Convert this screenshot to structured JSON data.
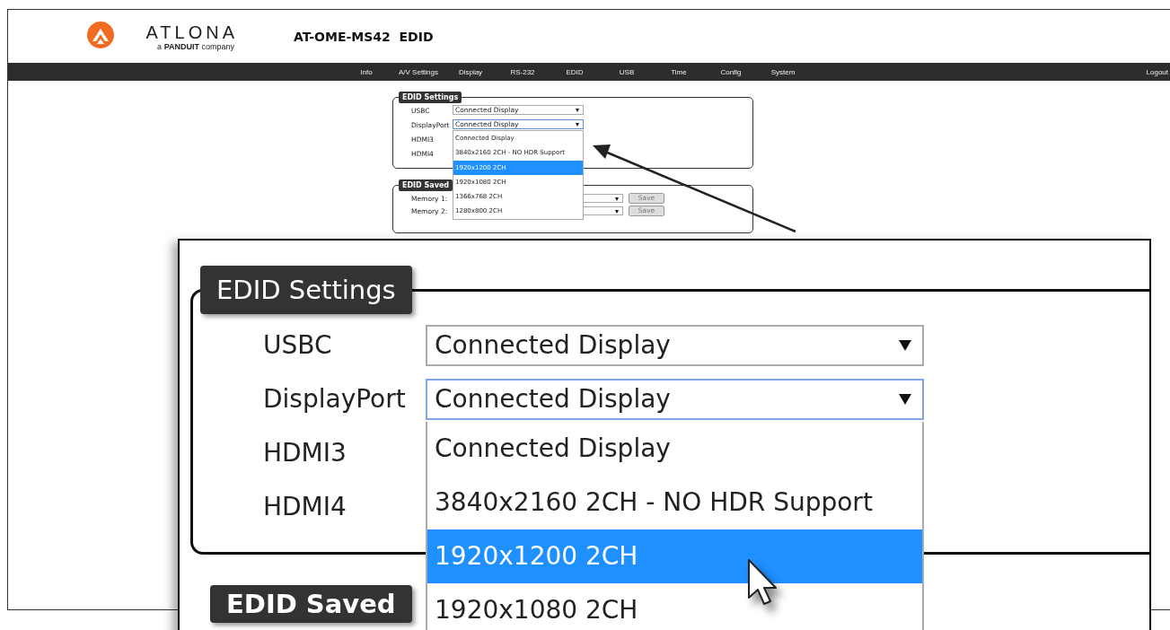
{
  "header": {
    "logo": {
      "wordmark": "ATLONA",
      "tagline": "a **PANDUIT** company"
    },
    "title": "AT-OME-MS42  EDID"
  },
  "nav": {
    "items": [
      "Info",
      "A/V Settings",
      "Display",
      "RS-232",
      "EDID",
      "USB",
      "Time",
      "Config",
      "System"
    ],
    "logout": "Logout"
  },
  "edid_settings": {
    "title": "EDID Settings",
    "inputs": [
      {
        "label": "USBC",
        "value": "Connected Display",
        "open": false
      },
      {
        "label": "DisplayPort",
        "value": "Connected Display",
        "open": true
      },
      {
        "label": "HDMI3"
      },
      {
        "label": "HDMI4"
      }
    ],
    "dropdown_options": [
      {
        "label": "Connected Display",
        "selected": false
      },
      {
        "label": "3840x2160 2CH - NO HDR Support",
        "selected": false
      },
      {
        "label": "1920x1200 2CH",
        "selected": true
      },
      {
        "label": "1920x1080 2CH",
        "selected": false
      },
      {
        "label": "1366x768 2CH",
        "selected": false
      },
      {
        "label": "1280x800 2CH",
        "selected": false
      }
    ]
  },
  "edid_saved": {
    "title": "EDID Saved",
    "rows": [
      {
        "label": "Memory 1:",
        "button": "Save"
      },
      {
        "label": "Memory 2:",
        "button": "Save"
      }
    ]
  },
  "zoom_inset": {
    "edid_settings": {
      "title": "EDID Settings",
      "inputs": [
        {
          "label": "USBC",
          "value": "Connected Display",
          "open": false
        },
        {
          "label": "DisplayPort",
          "value": "Connected Display",
          "open": true
        },
        {
          "label": "HDMI3"
        },
        {
          "label": "HDMI4"
        }
      ],
      "dropdown_options": [
        {
          "label": "Connected Display",
          "selected": false
        },
        {
          "label": "3840x2160 2CH - NO HDR Support",
          "selected": false
        },
        {
          "label": "1920x1200 2CH",
          "selected": true
        },
        {
          "label": "1920x1080 2CH",
          "selected": false
        }
      ]
    },
    "edid_saved": {
      "title": "EDID Saved"
    }
  }
}
